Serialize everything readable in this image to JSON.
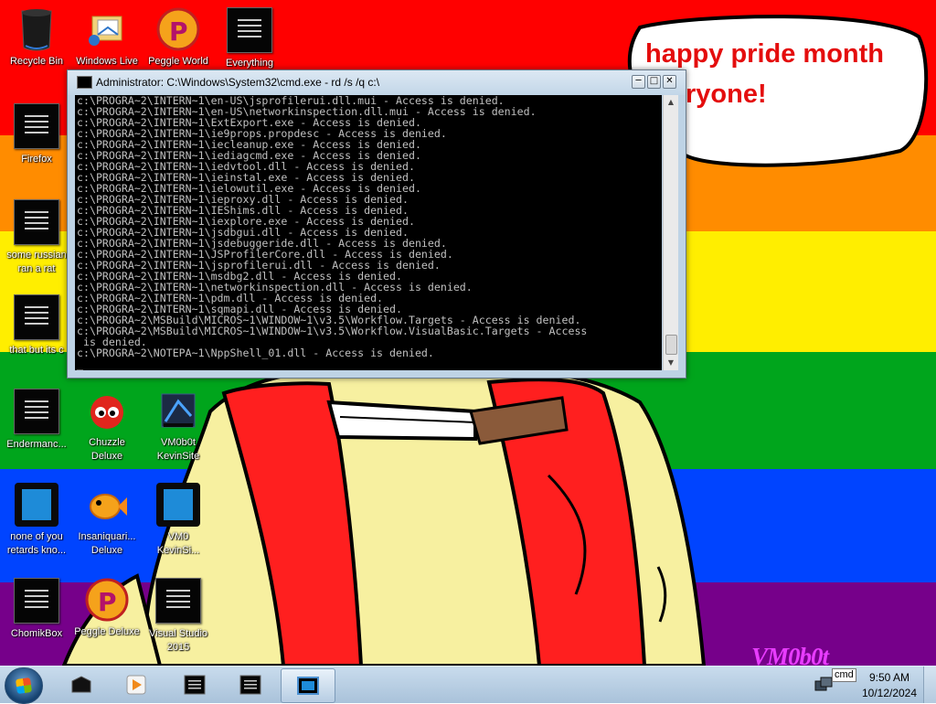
{
  "desktop": {
    "wallpaper": {
      "speech_bubble": {
        "line1": "happy pride month",
        "line2": "ryone!"
      },
      "watermark": "VM0b0t",
      "stripe_colors": [
        "#ff0000",
        "#ff8c00",
        "#ffee00",
        "#00a51c",
        "#0044ff",
        "#76008a"
      ]
    },
    "icons": [
      {
        "label": "Recycle Bin",
        "icon": "recycle-bin-icon"
      },
      {
        "label": "Windows Live",
        "icon": "windows-live-icon"
      },
      {
        "label": "Peggle World",
        "icon": "peggle-icon"
      },
      {
        "label": "Everything",
        "icon": "terminal-icon"
      },
      {
        "label": "Firefox",
        "icon": "terminal-icon"
      },
      {
        "label": "some russian",
        "label2": "ran a rat",
        "icon": "terminal-icon"
      },
      {
        "label": "that but its c",
        "icon": "terminal-icon"
      },
      {
        "label": "Endermanc...",
        "icon": "terminal-icon"
      },
      {
        "label": "Chuzzle",
        "label2": "Deluxe",
        "icon": "chuzzle-icon"
      },
      {
        "label": "VM0b0t",
        "label2": "KevinSite",
        "icon": "vmbot-icon"
      },
      {
        "label": "none of you",
        "label2": "retards kno...",
        "icon": "tablet-icon"
      },
      {
        "label": "Insaniquari...",
        "label2": "Deluxe",
        "icon": "goldfish-icon"
      },
      {
        "label": "VM0",
        "label2": "KevinSi...",
        "icon": "tablet-icon"
      },
      {
        "label": "ChomikBox",
        "icon": "terminal-icon"
      },
      {
        "label": "Peggle Deluxe",
        "icon": "peggle-icon"
      },
      {
        "label": "Visual Studio",
        "label2": "2015",
        "icon": "terminal-icon"
      }
    ]
  },
  "cmd_window": {
    "title": "Administrator: C:\\Windows\\System32\\cmd.exe - rd  /s /q c:\\",
    "buttons": {
      "minimize": "─",
      "maximize": "□",
      "close": "✕"
    },
    "console_text": "c:\\PROGRA~2\\INTERN~1\\en-US\\jsprofilerui.dll.mui - Access is denied.\nc:\\PROGRA~2\\INTERN~1\\en-US\\networkinspection.dll.mui - Access is denied.\nc:\\PROGRA~2\\INTERN~1\\ExtExport.exe - Access is denied.\nc:\\PROGRA~2\\INTERN~1\\ie9props.propdesc - Access is denied.\nc:\\PROGRA~2\\INTERN~1\\iecleanup.exe - Access is denied.\nc:\\PROGRA~2\\INTERN~1\\iediagcmd.exe - Access is denied.\nc:\\PROGRA~2\\INTERN~1\\iedvtool.dll - Access is denied.\nc:\\PROGRA~2\\INTERN~1\\ieinstal.exe - Access is denied.\nc:\\PROGRA~2\\INTERN~1\\ielowutil.exe - Access is denied.\nc:\\PROGRA~2\\INTERN~1\\ieproxy.dll - Access is denied.\nc:\\PROGRA~2\\INTERN~1\\IEShims.dll - Access is denied.\nc:\\PROGRA~2\\INTERN~1\\iexplore.exe - Access is denied.\nc:\\PROGRA~2\\INTERN~1\\jsdbgui.dll - Access is denied.\nc:\\PROGRA~2\\INTERN~1\\jsdebuggeride.dll - Access is denied.\nc:\\PROGRA~2\\INTERN~1\\JSProfilerCore.dll - Access is denied.\nc:\\PROGRA~2\\INTERN~1\\jsprofilerui.dll - Access is denied.\nc:\\PROGRA~2\\INTERN~1\\msdbg2.dll - Access is denied.\nc:\\PROGRA~2\\INTERN~1\\networkinspection.dll - Access is denied.\nc:\\PROGRA~2\\INTERN~1\\pdm.dll - Access is denied.\nc:\\PROGRA~2\\INTERN~1\\sqmapi.dll - Access is denied.\nc:\\PROGRA~2\\MSBuild\\MICROS~1\\WINDOW~1\\v3.5\\Workflow.Targets - Access is denied.\nc:\\PROGRA~2\\MSBuild\\MICROS~1\\WINDOW~1\\v3.5\\Workflow.VisualBasic.Targets - Access\n is denied.\nc:\\PROGRA~2\\NOTEPA~1\\NppShell_01.dll - Access is denied.\n_"
  },
  "taskbar": {
    "tray_tooltip": "cmd",
    "clock_time": "9:50 AM",
    "clock_date": "10/12/2024",
    "pinned": [
      {
        "icon": "black-box-icon"
      },
      {
        "icon": "media-player-icon"
      },
      {
        "icon": "terminal-icon"
      },
      {
        "icon": "terminal-icon"
      },
      {
        "icon": "cmd-window-icon",
        "active": true
      }
    ]
  }
}
